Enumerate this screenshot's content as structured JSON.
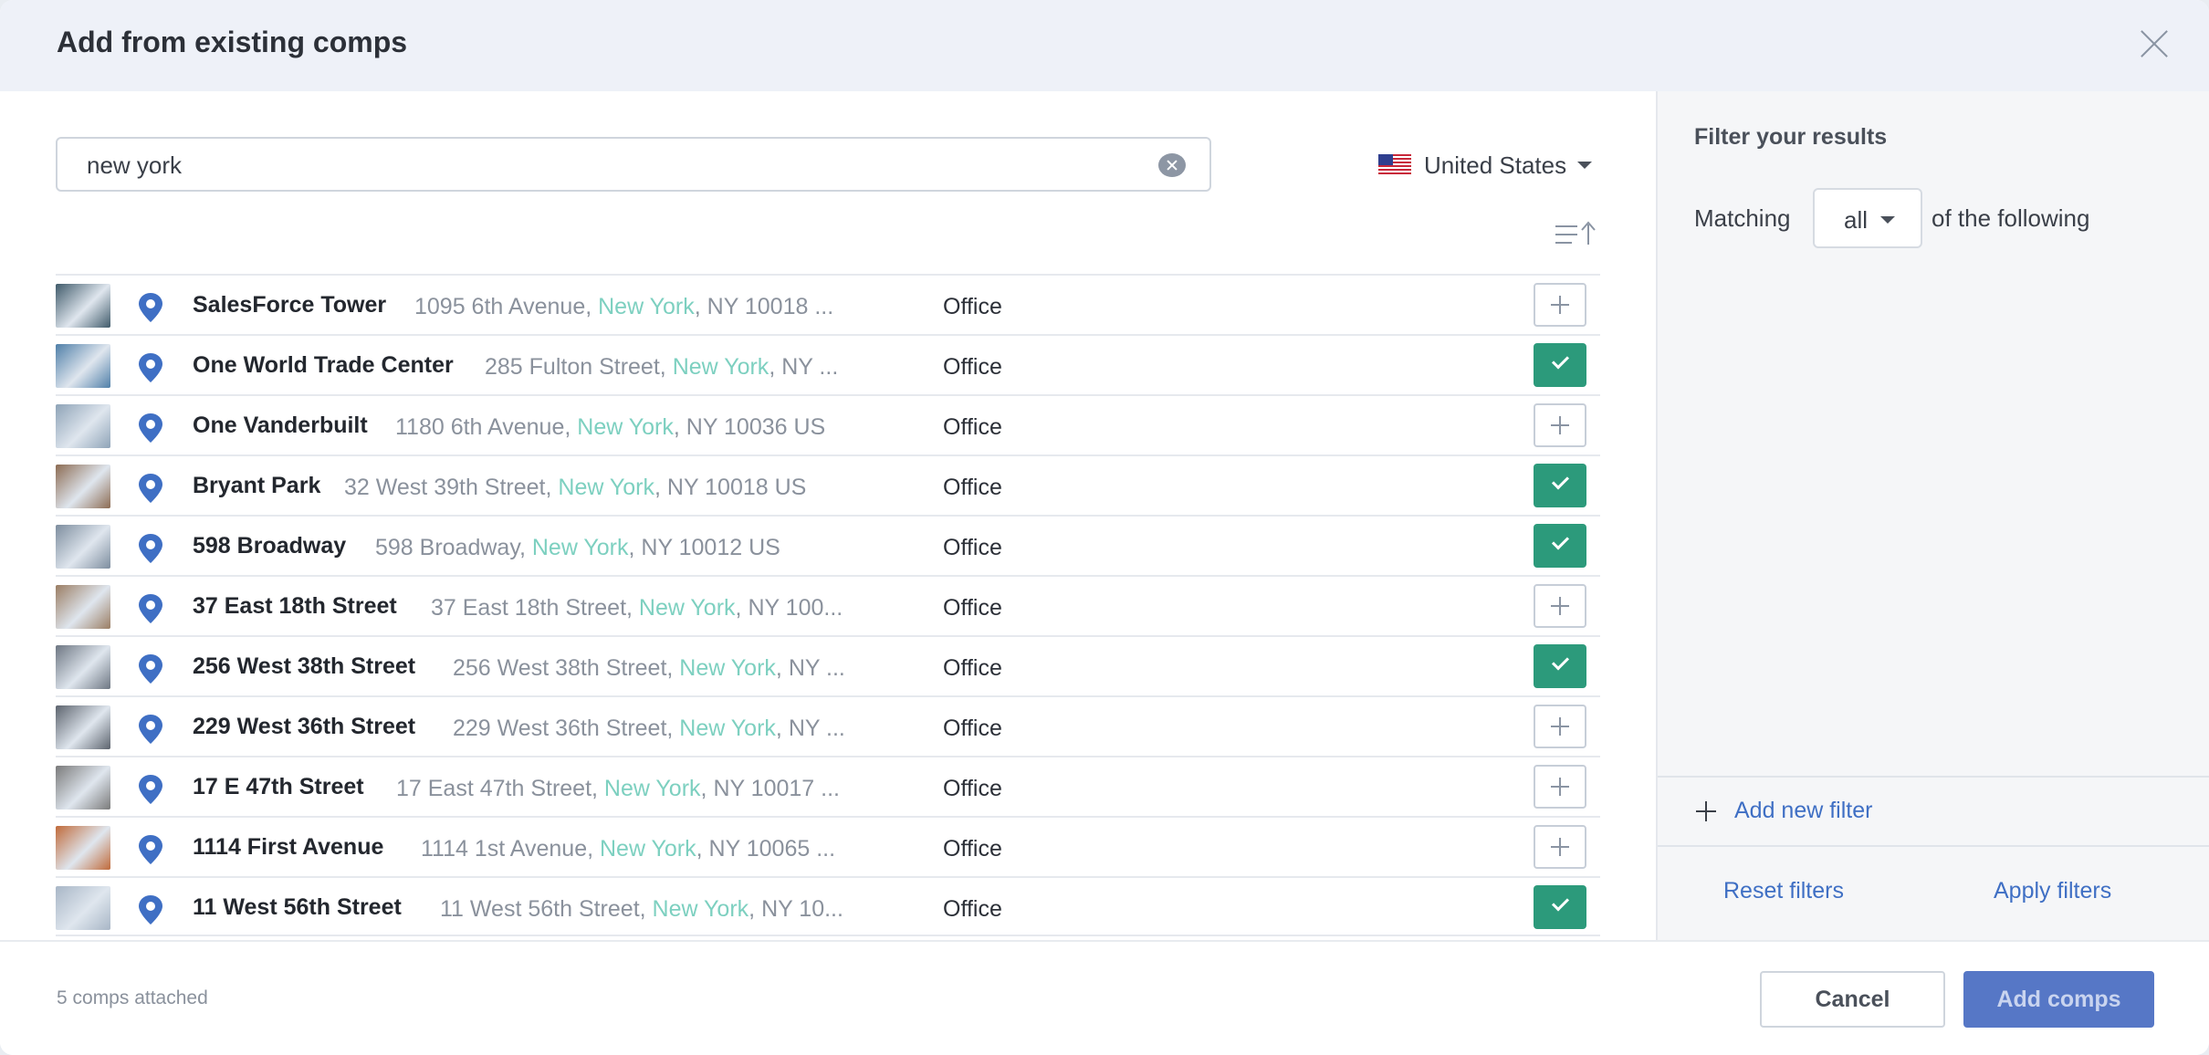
{
  "dialog": {
    "title": "Add from existing comps"
  },
  "search": {
    "value": "new york"
  },
  "country": {
    "label": "United States"
  },
  "rows": [
    {
      "name": "SalesForce Tower",
      "street": "1095 6th Avenue, ",
      "city": "New York",
      "rest": ", NY 10018 ...",
      "type": "Office",
      "selected": false,
      "thumb_color": "#3f5a6a"
    },
    {
      "name": "One World Trade Center",
      "street": "285 Fulton Street, ",
      "city": "New York",
      "rest": ", NY ...",
      "type": "Office",
      "selected": true,
      "thumb_color": "#4f7fa8"
    },
    {
      "name": "One Vanderbuilt",
      "street": "1180 6th Avenue, ",
      "city": "New York",
      "rest": ", NY 10036 US",
      "type": "Office",
      "selected": false,
      "thumb_color": "#8ea3b7"
    },
    {
      "name": "Bryant Park",
      "street": "32 West 39th Street, ",
      "city": "New York",
      "rest": ", NY 10018 US",
      "type": "Office",
      "selected": true,
      "thumb_color": "#8c6b52"
    },
    {
      "name": "598 Broadway",
      "street": "598 Broadway, ",
      "city": "New York",
      "rest": ", NY 10012 US",
      "type": "Office",
      "selected": true,
      "thumb_color": "#7d8d9e"
    },
    {
      "name": "37 East 18th Street",
      "street": "37 East 18th Street, ",
      "city": "New York",
      "rest": ", NY 100...",
      "type": "Office",
      "selected": false,
      "thumb_color": "#9a7d63"
    },
    {
      "name": "256 West 38th Street",
      "street": "256 West 38th Street, ",
      "city": "New York",
      "rest": ", NY ...",
      "type": "Office",
      "selected": true,
      "thumb_color": "#6d7682"
    },
    {
      "name": "229 West 36th Street",
      "street": "229 West 36th Street, ",
      "city": "New York",
      "rest": ", NY ...",
      "type": "Office",
      "selected": false,
      "thumb_color": "#5c636d"
    },
    {
      "name": "17 E 47th Street",
      "street": "17 East 47th Street, ",
      "city": "New York",
      "rest": ", NY 10017 ...",
      "type": "Office",
      "selected": false,
      "thumb_color": "#7a7a7a"
    },
    {
      "name": "1114 First Avenue",
      "street": "1114 1st Avenue, ",
      "city": "New York",
      "rest": ", NY 10065 ...",
      "type": "Office",
      "selected": false,
      "thumb_color": "#c06a3a"
    },
    {
      "name": "11 West 56th Street",
      "street": "11 West 56th Street, ",
      "city": "New York",
      "rest": ", NY 10...",
      "type": "Office",
      "selected": true,
      "thumb_color": "#a8b6c6"
    }
  ],
  "filters": {
    "title": "Filter your results",
    "matching_label": "Matching",
    "matching_value": "all",
    "following_label": "of the following",
    "add_filter": "Add new filter",
    "reset": "Reset filters",
    "apply": "Apply filters"
  },
  "footer": {
    "attached": "5 comps attached",
    "cancel": "Cancel",
    "add": "Add comps"
  },
  "colors": {
    "selected": "#2c9a7b",
    "pin": "#3f6fc4",
    "city_highlight": "#7dd0c0",
    "primary": "#5677c6"
  },
  "icons": {
    "close": "close-icon",
    "clear": "clear-search-icon",
    "flag": "us-flag-icon",
    "sort": "sort-ascending-icon",
    "pin": "location-pin-icon",
    "add": "plus-icon",
    "check": "check-icon"
  }
}
